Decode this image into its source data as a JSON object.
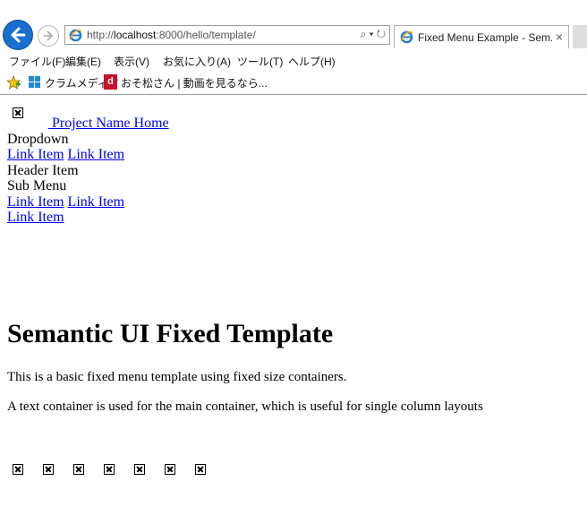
{
  "browser": {
    "url_prefix": "http://",
    "url_host": "localhost",
    "url_rest": ":8000/hello/template/",
    "tab_title": "Fixed Menu Example - Sem...",
    "tab_close": "×",
    "addr_tools": "⌕ ▾ ↻"
  },
  "menubar": {
    "items": [
      "ファイル(F)",
      "編集(E)",
      "表示(V)",
      "お気に入り(A)",
      "ツール(T)",
      "ヘルプ(H)"
    ]
  },
  "favorites": {
    "items": [
      "クラムメディア",
      "おそ松さん | 動画を見るなら..."
    ],
    "d_icon_text": "d"
  },
  "page": {
    "home_link": "Project Name Home",
    "dropdown": "Dropdown",
    "link_item": "Link Item",
    "header_item": "Header Item",
    "sub_menu": "Sub Menu",
    "heading": "Semantic UI Fixed Template",
    "para1": "This is a basic fixed menu template using fixed size containers.",
    "para2": "A text container is used for the main container, which is useful for single column layouts"
  }
}
